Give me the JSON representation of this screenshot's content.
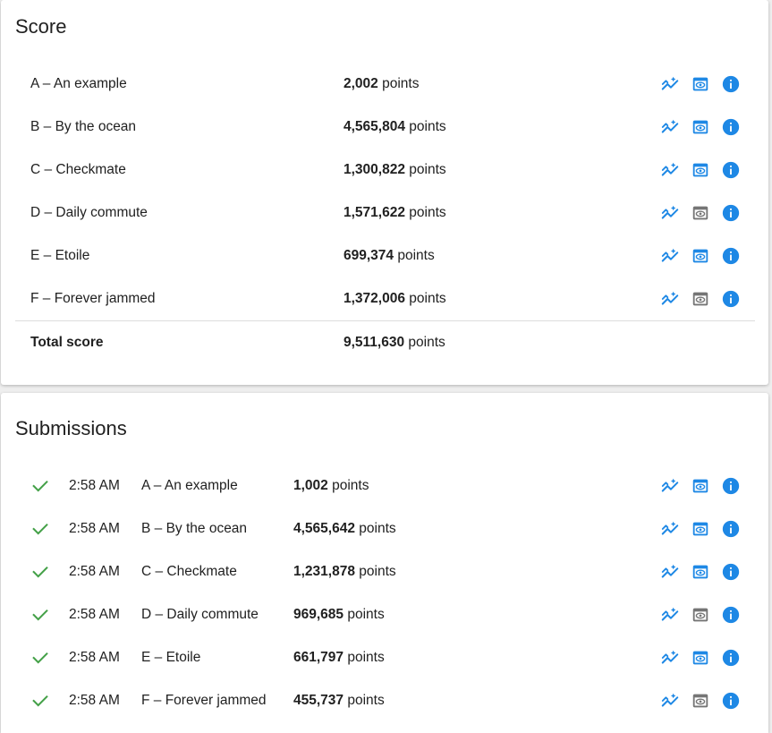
{
  "colors": {
    "accent": "#1e88e5",
    "muted": "#757575",
    "success": "#43a047"
  },
  "score": {
    "title": "Score",
    "rows": [
      {
        "problem": "A – An example",
        "points": "2,002",
        "unit": "points",
        "eye_active": true
      },
      {
        "problem": "B – By the ocean",
        "points": "4,565,804",
        "unit": "points",
        "eye_active": true
      },
      {
        "problem": "C – Checkmate",
        "points": "1,300,822",
        "unit": "points",
        "eye_active": true
      },
      {
        "problem": "D – Daily commute",
        "points": "1,571,622",
        "unit": "points",
        "eye_active": false
      },
      {
        "problem": "E – Etoile",
        "points": "699,374",
        "unit": "points",
        "eye_active": true
      },
      {
        "problem": "F – Forever jammed",
        "points": "1,372,006",
        "unit": "points",
        "eye_active": false
      }
    ],
    "total": {
      "label": "Total score",
      "points": "9,511,630",
      "unit": "points"
    }
  },
  "submissions": {
    "title": "Submissions",
    "rows": [
      {
        "status": "check-icon",
        "time": "2:58 AM",
        "problem": "A – An example",
        "points": "1,002",
        "unit": "points",
        "eye_active": true
      },
      {
        "status": "check-icon",
        "time": "2:58 AM",
        "problem": "B – By the ocean",
        "points": "4,565,642",
        "unit": "points",
        "eye_active": true
      },
      {
        "status": "check-icon",
        "time": "2:58 AM",
        "problem": "C – Checkmate",
        "points": "1,231,878",
        "unit": "points",
        "eye_active": true
      },
      {
        "status": "check-icon",
        "time": "2:58 AM",
        "problem": "D – Daily commute",
        "points": "969,685",
        "unit": "points",
        "eye_active": false
      },
      {
        "status": "check-icon",
        "time": "2:58 AM",
        "problem": "E – Etoile",
        "points": "661,797",
        "unit": "points",
        "eye_active": true
      },
      {
        "status": "check-icon",
        "time": "2:58 AM",
        "problem": "F – Forever jammed",
        "points": "455,737",
        "unit": "points",
        "eye_active": false
      }
    ]
  },
  "icons": {
    "chart": "auto-graph-icon",
    "view": "preview-icon",
    "info": "info-icon"
  }
}
